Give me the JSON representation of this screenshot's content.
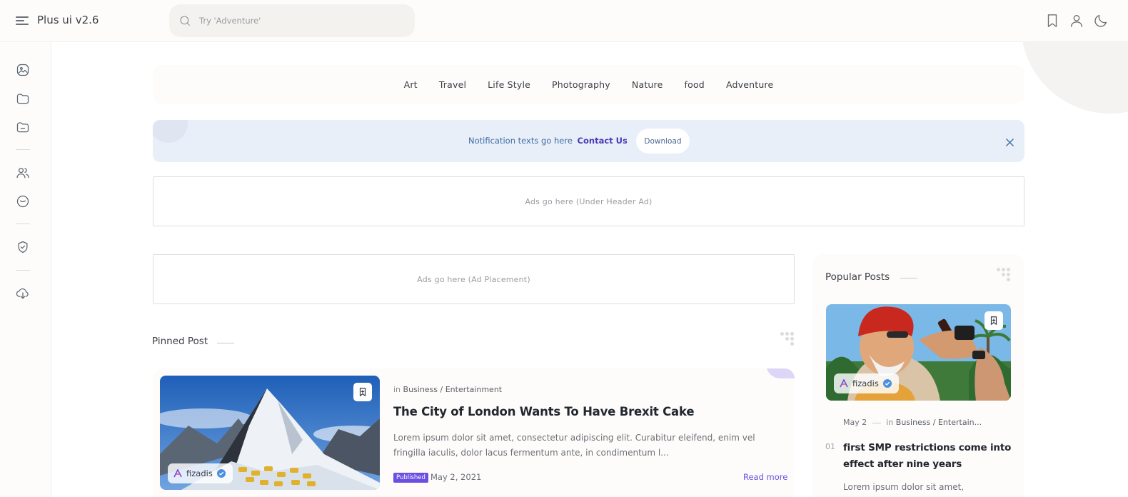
{
  "header": {
    "brand": "Plus ui v2.6",
    "search_placeholder": "Try 'Adventure'"
  },
  "nav": {
    "categories": [
      "Art",
      "Travel",
      "Life Style",
      "Photography",
      "Nature",
      "food",
      "Adventure"
    ]
  },
  "notification": {
    "text": "Notification texts go here",
    "link": "Contact Us",
    "button": "Download"
  },
  "ads": {
    "header_ad": "Ads go here (Under Header Ad)",
    "placement_ad": "Ads go here (Ad Placement)"
  },
  "pinned": {
    "section_title": "Pinned Post",
    "post": {
      "in_label": "in",
      "category": "Business / Entertainment",
      "title": "The City of London Wants To Have Brexit Cake",
      "excerpt": "Lorem ipsum dolor sit amet, consectetur adipiscing elit. Curabitur eleifend, enim vel fringilla iaculis, dolor lacus fermentum ante, in condimentum l...",
      "badge": "Published",
      "date": "May 2, 2021",
      "read_more": "Read more",
      "author": "fizadis"
    }
  },
  "popular": {
    "section_title": "Popular Posts",
    "post": {
      "author": "fizadis",
      "date": "May 2",
      "in_label": "in",
      "category": "Business / Entertain...",
      "number": "01",
      "title": "first SMP restrictions come into effect after nine years",
      "excerpt": "Lorem ipsum dolor sit amet,"
    }
  },
  "icons": {
    "header_right": [
      "bookmark-icon",
      "user-icon",
      "moon-icon"
    ],
    "sidebar": [
      "image-icon",
      "folder-icon",
      "folder-minus-icon",
      "users-icon",
      "smiley-icon",
      "shield-check-icon",
      "download-cloud-icon"
    ]
  },
  "colors": {
    "accent": "#6b4fe0",
    "notification_bg": "#e8eff9",
    "notification_link": "#4b39b7",
    "verified": "#4a90e2"
  }
}
